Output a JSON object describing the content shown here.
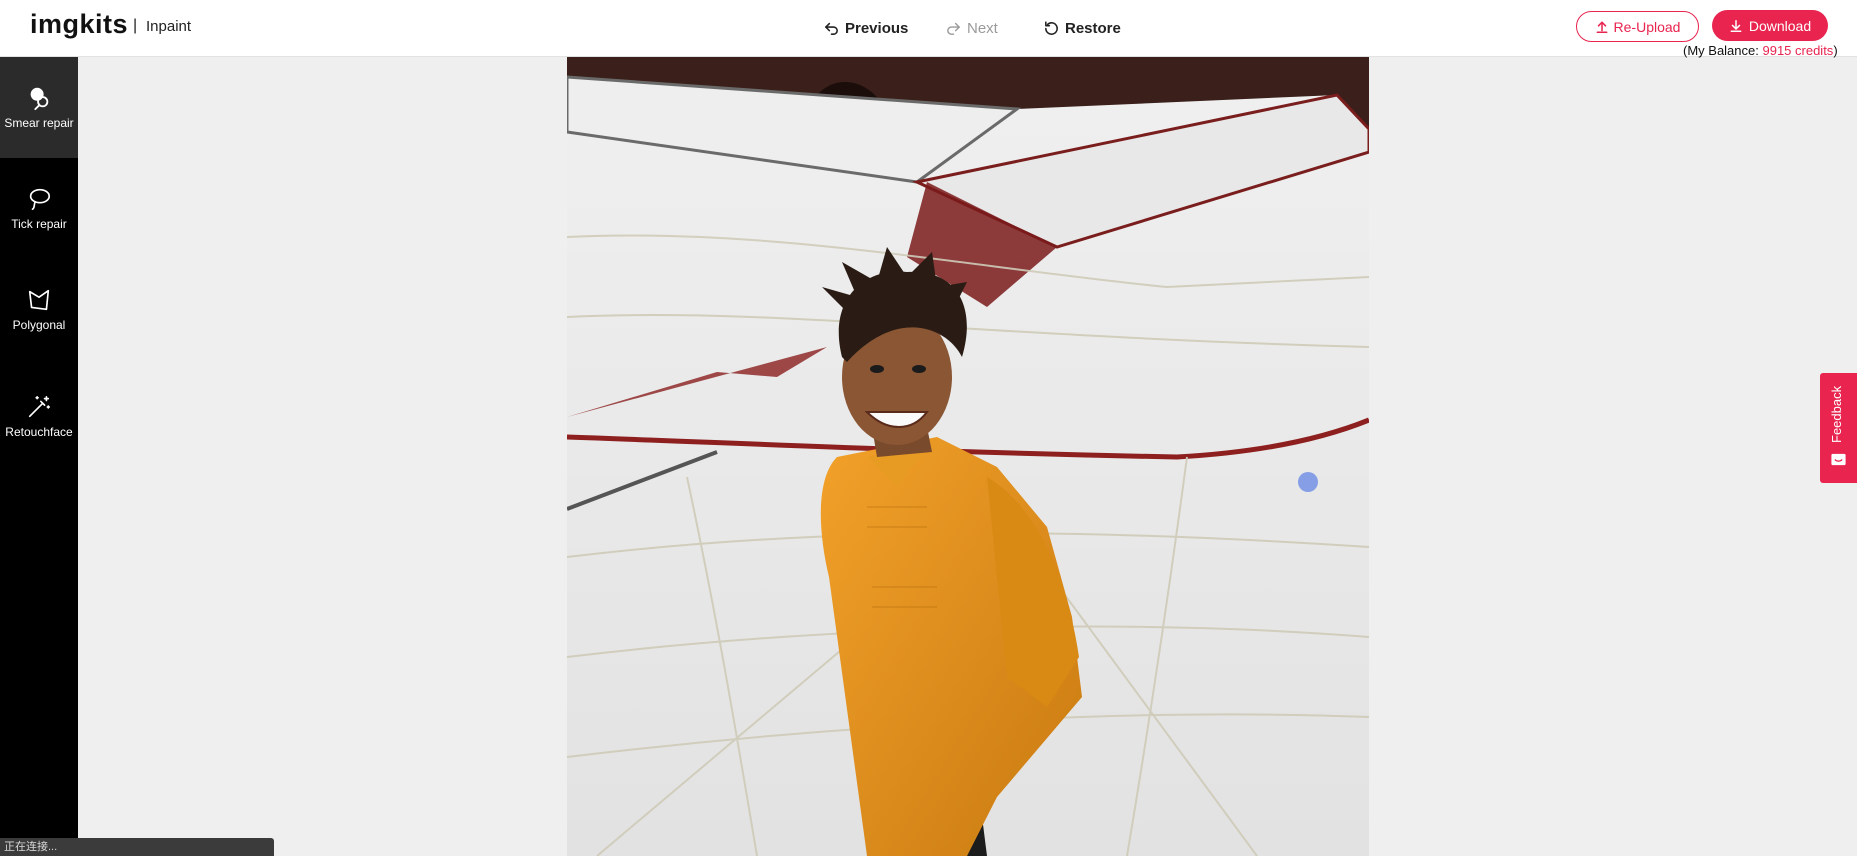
{
  "header": {
    "logo": "imgkits",
    "separator": "|",
    "app_name": "Inpaint",
    "previous_label": "Previous",
    "next_label": "Next",
    "restore_label": "Restore",
    "reupload_label": "Re-Upload",
    "download_label": "Download",
    "balance_prefix": "(My Balance: ",
    "balance_value": "9915 credits",
    "balance_suffix": ")"
  },
  "sidebar": {
    "tools": [
      {
        "label": "Smear repair",
        "icon": "smear-brush-icon",
        "active": true
      },
      {
        "label": "Tick repair",
        "icon": "lasso-icon",
        "active": false
      },
      {
        "label": "Polygonal",
        "icon": "polygon-icon",
        "active": false
      },
      {
        "label": "Retouchface",
        "icon": "magic-wand-icon",
        "active": false
      }
    ]
  },
  "feedback": {
    "label": "Feedback",
    "icon": "feedback-icon"
  },
  "status_bar": {
    "text": "正在连接..."
  },
  "colors": {
    "accent": "#e8244f",
    "sidebar": "#000000",
    "canvas_bg": "#efefef"
  }
}
